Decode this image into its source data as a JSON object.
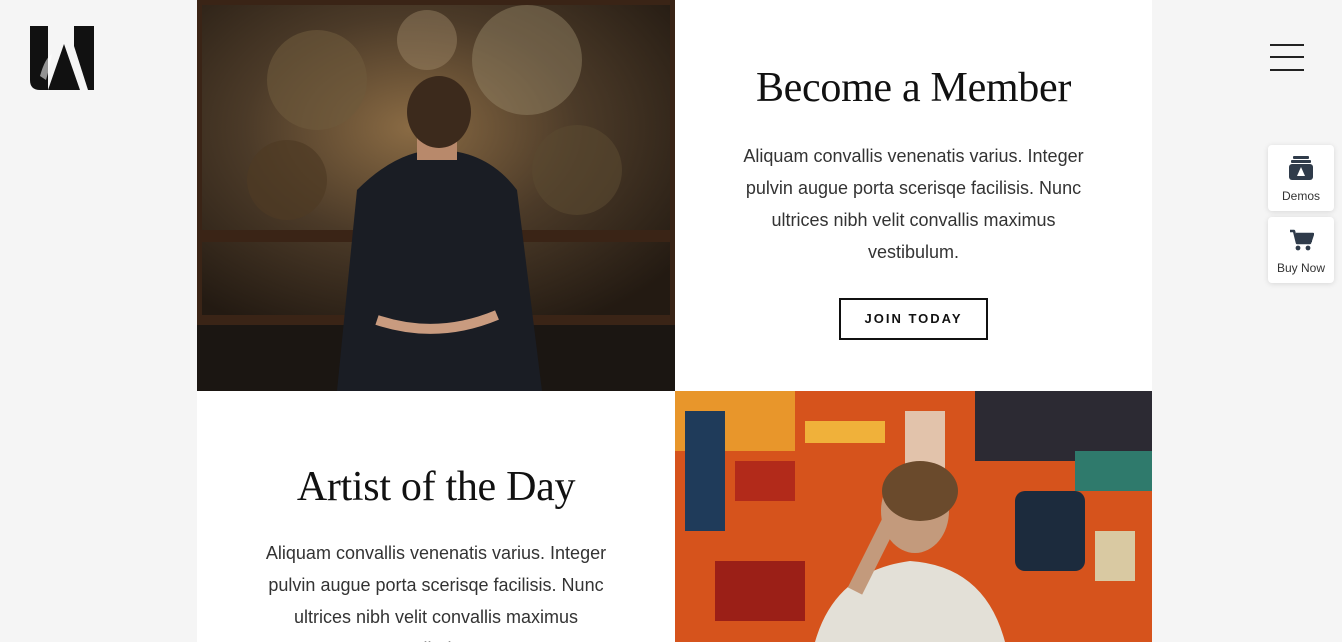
{
  "header": {
    "logo_alt": "logo",
    "menu_label": "menu"
  },
  "sections": [
    {
      "title": "Become a Member",
      "body": "Aliquam convallis venenatis varius. Integer pulvin augue porta scerisqe facilisis. Nunc ultrices nibh velit convallis maximus vestibulum.",
      "button": "JOIN TODAY"
    },
    {
      "title": "Artist of the Day",
      "body": "Aliquam convallis venenatis varius. Integer pulvin augue porta scerisqe facilisis. Nunc ultrices nibh velit convallis maximus vestibulum."
    }
  ],
  "side_panel": {
    "demos_label": "Demos",
    "buy_label": "Buy Now"
  },
  "colors": {
    "page_bg": "#f5f5f5",
    "text": "#111111",
    "accent_dark": "#2f3b4a"
  }
}
